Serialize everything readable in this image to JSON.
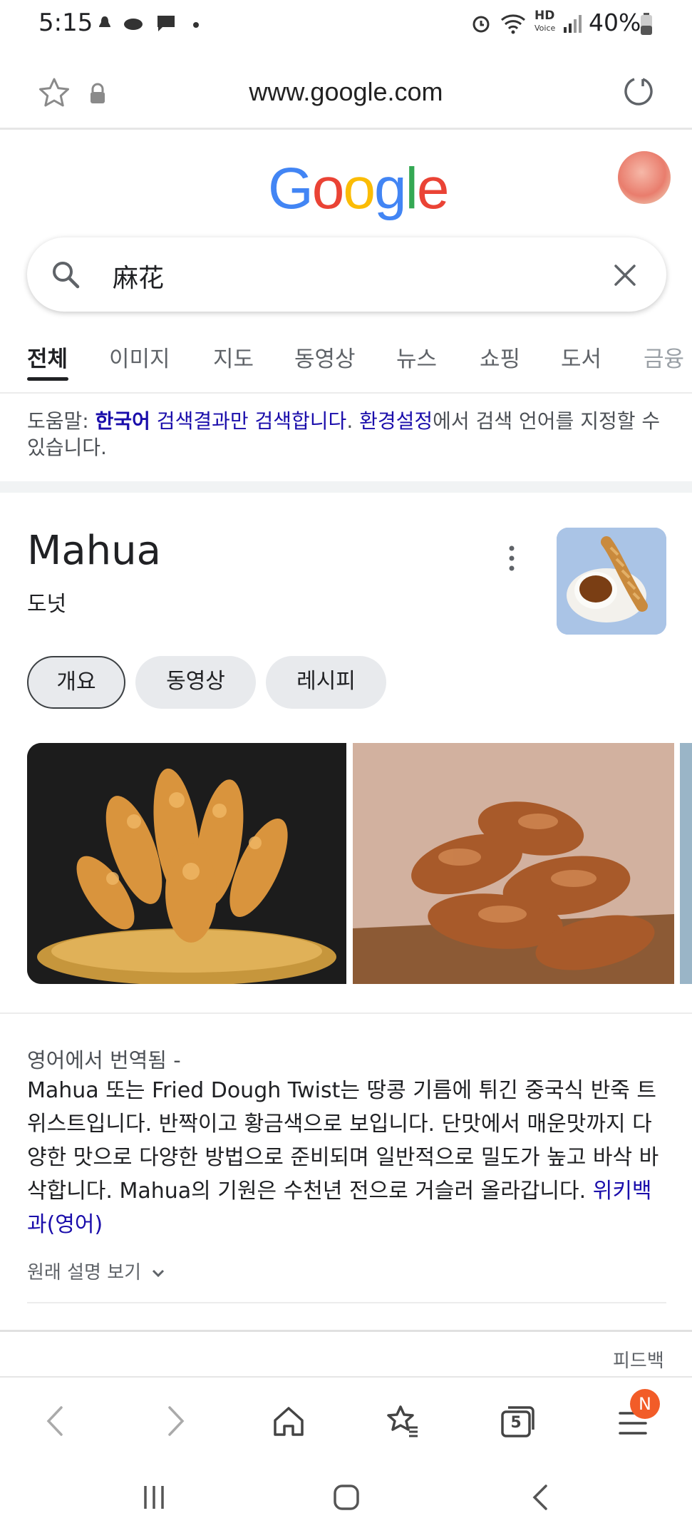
{
  "status_bar": {
    "time": "5:15",
    "battery": "40%",
    "hd_label": "HD",
    "voice_label": "Voice"
  },
  "address_bar": {
    "url": "www.google.com"
  },
  "header": {
    "logo_letters": [
      "G",
      "o",
      "o",
      "g",
      "l",
      "e"
    ],
    "logo_colors": [
      "#4285F4",
      "#EA4335",
      "#FBBC05",
      "#4285F4",
      "#34A853",
      "#EA4335"
    ]
  },
  "search": {
    "query": "麻花"
  },
  "tabs": [
    "전체",
    "이미지",
    "지도",
    "동영상",
    "뉴스",
    "쇼핑",
    "도서",
    "금융"
  ],
  "notice": {
    "prefix": "도움말: ",
    "lang": "한국어",
    "link_rest": " 검색결과만 검색합니다",
    "dot": ". ",
    "settings": "환경설정",
    "suffix": "에서 검색 언어를 지정할 수 있습니다."
  },
  "knowledge_panel": {
    "title": "Mahua",
    "subtitle": "도넛",
    "chips": [
      "개요",
      "동영상",
      "레시피"
    ],
    "translated_label": "영어에서 번역됨 -",
    "description": "Mahua 또는 Fried Dough Twist는 땅콩 기름에 튀긴 중국식 반죽 트위스트입니다. 반짝이고 황금색으로 보입니다. 단맛에서 매운맛까지 다양한 맛으로 다양한 방법으로 준비되며 일반적으로 밀도가 높고 바삭 바삭합니다. Mahua의 기원은 수천년 전으로 거슬러 올라갑니다. ",
    "source_link": "위키백과(영어)",
    "show_original": "원래 설명 보기",
    "feedback": "피드백"
  },
  "bottom_bar": {
    "badge": "N",
    "tab_count": "5"
  },
  "colors": {
    "accent_link": "#1a0dab",
    "badge": "#f25c28"
  }
}
